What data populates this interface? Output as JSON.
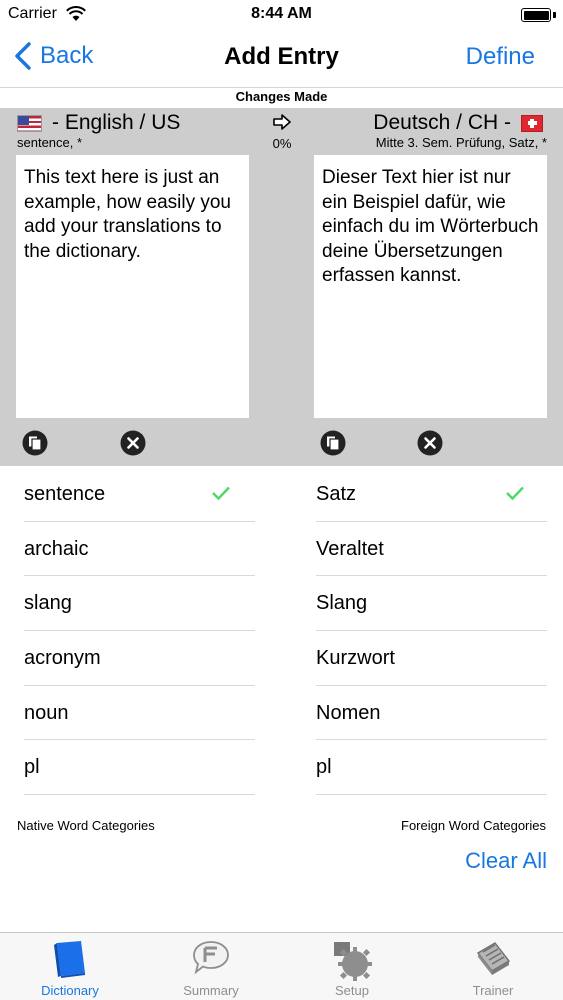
{
  "status_bar": {
    "carrier": "Carrier",
    "time": "8:44 AM"
  },
  "nav": {
    "back_label": "Back",
    "title": "Add Entry",
    "define_label": "Define"
  },
  "changes_label": "Changes Made",
  "editor": {
    "native_language": "- English / US",
    "foreign_language": "Deutsch / CH -",
    "native_flag": "us-flag-icon",
    "foreign_flag": "switzerland-flag-icon",
    "native_subtitle": "sentence, *",
    "foreign_subtitle": "Mitte 3. Sem. Prüfung, Satz, *",
    "progress": "0%",
    "native_text": "This text here is just an example, how easily you add your translations to the dictionary.",
    "foreign_text": "Dieser Text hier ist nur ein Beispiel dafür, wie einfach du im Wörterbuch deine Übersetzungen erfassen kannst."
  },
  "native_categories": [
    {
      "label": "sentence",
      "checked": true
    },
    {
      "label": "archaic",
      "checked": false
    },
    {
      "label": "slang",
      "checked": false
    },
    {
      "label": "acronym",
      "checked": false
    },
    {
      "label": "noun",
      "checked": false
    },
    {
      "label": "pl",
      "checked": false
    }
  ],
  "foreign_categories": [
    {
      "label": "Satz",
      "checked": true
    },
    {
      "label": "Veraltet",
      "checked": false
    },
    {
      "label": "Slang",
      "checked": false
    },
    {
      "label": "Kurzwort",
      "checked": false
    },
    {
      "label": "Nomen",
      "checked": false
    },
    {
      "label": "pl",
      "checked": false
    }
  ],
  "native_categories_label": "Native Word Categories",
  "foreign_categories_label": "Foreign Word Categories",
  "clear_all_label": "Clear All",
  "tabs": [
    {
      "label": "Dictionary",
      "icon": "book-icon",
      "active": true
    },
    {
      "label": "Summary",
      "icon": "speech-bubble-icon",
      "active": false
    },
    {
      "label": "Setup",
      "icon": "gear-icon",
      "active": false
    },
    {
      "label": "Trainer",
      "icon": "card-stack-icon",
      "active": false
    }
  ],
  "colors": {
    "accent": "#1877e0",
    "editor_background": "#cdcdcd",
    "check": "#4cd964"
  }
}
